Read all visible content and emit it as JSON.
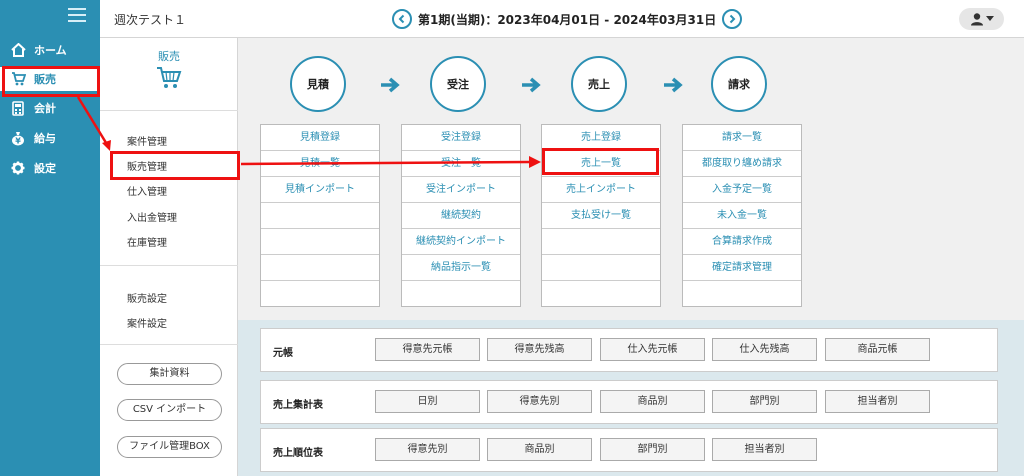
{
  "nav": {
    "items": [
      {
        "label": "ホーム",
        "icon": "home-icon"
      },
      {
        "label": "販売",
        "icon": "cart-icon"
      },
      {
        "label": "会計",
        "icon": "calculator-icon"
      },
      {
        "label": "給与",
        "icon": "yen-bag-icon"
      },
      {
        "label": "設定",
        "icon": "gear-icon"
      }
    ]
  },
  "header": {
    "company": "週次テスト１",
    "period": "第1期(当期)：2023年04月01日 - 2024年03月31日"
  },
  "sidebar": {
    "title": "販売",
    "group1": [
      "案件管理",
      "販売管理",
      "仕入管理",
      "入出金管理",
      "在庫管理"
    ],
    "group2": [
      "販売設定",
      "案件設定"
    ],
    "buttons": [
      "集計資料",
      "CSV インポート",
      "ファイル管理BOX"
    ]
  },
  "flow": {
    "steps": [
      "見積",
      "受注",
      "売上",
      "請求"
    ],
    "columns": [
      [
        "見積登録",
        "見積一覧",
        "見積インポート"
      ],
      [
        "受注登録",
        "受注一覧",
        "受注インポート",
        "継続契約",
        "継続契約インポート",
        "納品指示一覧"
      ],
      [
        "売上登録",
        "売上一覧",
        "売上インポート",
        "支払受け一覧"
      ],
      [
        "請求一覧",
        "都度取り纏め請求",
        "入金予定一覧",
        "未入金一覧",
        "合算請求作成",
        "確定請求管理"
      ]
    ]
  },
  "reports": [
    {
      "label": "元帳",
      "buttons": [
        "得意先元帳",
        "得意先残高",
        "仕入先元帳",
        "仕入先残高",
        "商品元帳"
      ]
    },
    {
      "label": "売上集計表",
      "buttons": [
        "日別",
        "得意先別",
        "商品別",
        "部門別",
        "担当者別"
      ]
    },
    {
      "label": "売上順位表",
      "buttons": [
        "得意先別",
        "商品別",
        "部門別",
        "担当者別"
      ]
    }
  ],
  "colors": {
    "accent": "#2b8fb3",
    "highlight": "#ee1111"
  }
}
